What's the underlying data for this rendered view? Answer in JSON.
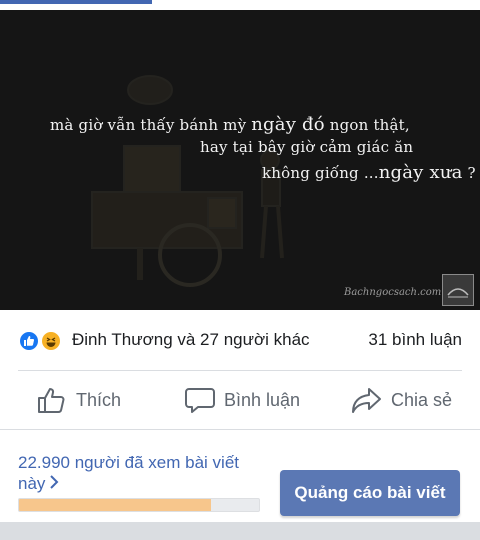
{
  "post_image": {
    "quote_line1_a": "mà giờ vẫn thấy bánh mỳ ",
    "quote_line1_b": "ngày đó",
    "quote_line1_c": " ngon thật,",
    "quote_line2": "hay tại bây giờ cảm giác ăn",
    "quote_line3_a": "không giống ...",
    "quote_line3_b": "ngày xưa",
    "quote_line3_c": " ?",
    "watermark": "Bachngocsach.com"
  },
  "reactions": {
    "icons": [
      "like-icon",
      "haha-icon"
    ],
    "names": "Đinh Thương và 27 người khác",
    "comments": "31 bình luận"
  },
  "actions": {
    "like": "Thích",
    "comment": "Bình luận",
    "share": "Chia sẻ"
  },
  "insights": {
    "views": "22.990 người đã xem bài viết này",
    "reach_fraction": 0.8,
    "boost_label": "Quảng cáo bài viết"
  },
  "colors": {
    "accent": "#4267b2",
    "boost_button": "#5b78b4",
    "like_blue": "#1877f2",
    "haha_yellow": "#f7b125",
    "reach_fill": "#f7c68c"
  }
}
